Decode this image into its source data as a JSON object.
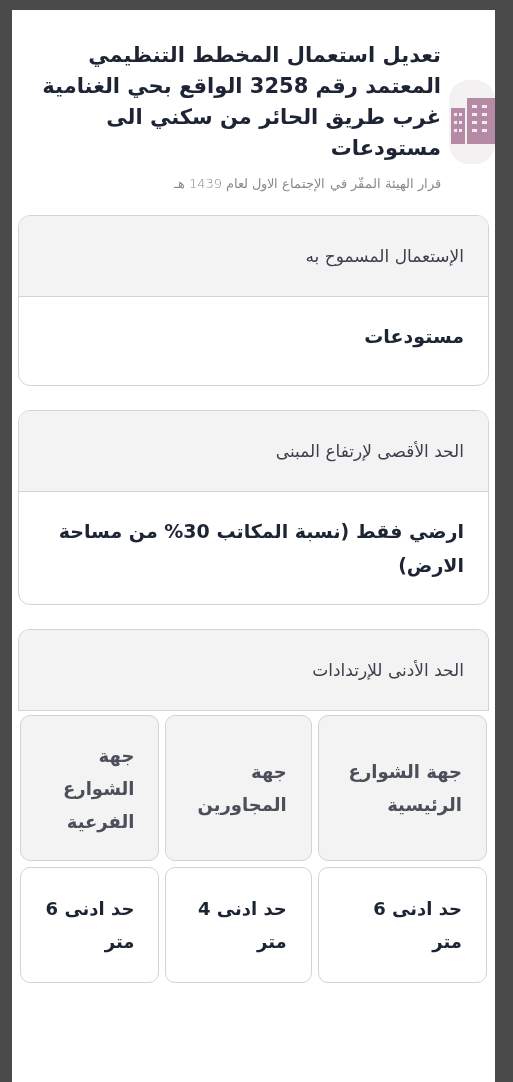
{
  "header": {
    "title": "تعديل استعمال المخطط التنظيمي المعتمد رقم 3258 الواقع بحي الغنامية غرب طريق الحائر من سكني الى مستودعات",
    "subtitle": "قرار الهيئة المقّر في الإجتماع الاول لعام 1439 هـ"
  },
  "sections": [
    {
      "kind": "field",
      "label": "الإستعمال المسموح به",
      "value": "مستودعات"
    },
    {
      "kind": "field",
      "label": "الحد الأقصى لإرتفاع المبنى",
      "value": "ارضي فقط (نسبة المكاتب 30% من مساحة الارض)"
    },
    {
      "kind": "grid",
      "label": "الحد الأدنى للإرتدادات",
      "columns": [
        {
          "heading": "جهة الشوارع الرئيسية",
          "value": "حد ادنى 6 متر"
        },
        {
          "heading": "جهة المجاورين",
          "value": "حد ادنى 4 متر"
        },
        {
          "heading": "جهة الشوارع الفرعية",
          "value": "حد ادنى 6 متر"
        }
      ]
    }
  ]
}
